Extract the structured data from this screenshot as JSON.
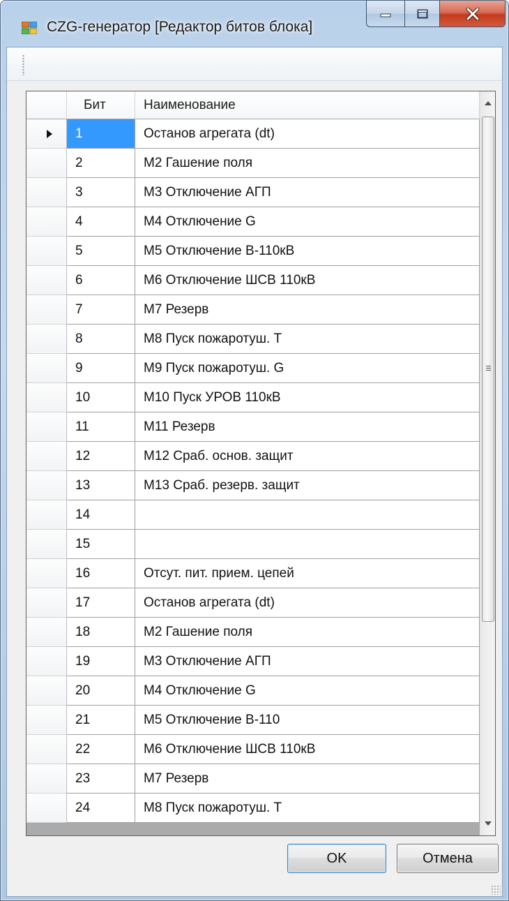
{
  "window": {
    "title": "CZG-генератор [Редактор битов блока]"
  },
  "grid": {
    "columns": [
      "Бит",
      "Наименование"
    ],
    "selected_row": 0,
    "rows": [
      {
        "bit": "1",
        "name": "Останов агрегата (dt)"
      },
      {
        "bit": "2",
        "name": "М2 Гашение поля"
      },
      {
        "bit": "3",
        "name": "М3 Отключение АГП"
      },
      {
        "bit": "4",
        "name": "М4 Отключение G"
      },
      {
        "bit": "5",
        "name": "М5 Отключение В-110кВ"
      },
      {
        "bit": "6",
        "name": "М6 Отключение ШСВ 110кВ"
      },
      {
        "bit": "7",
        "name": "М7 Резерв"
      },
      {
        "bit": "8",
        "name": "М8 Пуск пожаротуш. Т"
      },
      {
        "bit": "9",
        "name": "М9 Пуск пожаротуш. G"
      },
      {
        "bit": "10",
        "name": "М10 Пуск УРОВ 110кВ"
      },
      {
        "bit": "11",
        "name": "М11 Резерв"
      },
      {
        "bit": "12",
        "name": "М12 Сраб. основ. защит"
      },
      {
        "bit": "13",
        "name": "М13 Сраб. резерв. защит"
      },
      {
        "bit": "14",
        "name": ""
      },
      {
        "bit": "15",
        "name": ""
      },
      {
        "bit": "16",
        "name": "Отсут. пит. прием. цепей"
      },
      {
        "bit": "17",
        "name": "Останов агрегата (dt)"
      },
      {
        "bit": "18",
        "name": "М2 Гашение поля"
      },
      {
        "bit": "19",
        "name": "М3 Отключение АГП"
      },
      {
        "bit": "20",
        "name": "М4 Отключение G"
      },
      {
        "bit": "21",
        "name": "М5 Отключение В-110"
      },
      {
        "bit": "22",
        "name": "М6 Отключение ШСВ 110кВ"
      },
      {
        "bit": "23",
        "name": "М7 Резерв"
      },
      {
        "bit": "24",
        "name": "М8 Пуск пожаротуш. Т"
      }
    ]
  },
  "buttons": {
    "ok": "OK",
    "cancel": "Отмена"
  },
  "colors": {
    "selection": "#3399ff",
    "close_button": "#c43a1c"
  },
  "icons": [
    "app-icon",
    "minimize-icon",
    "maximize-icon",
    "close-icon",
    "row-pointer-icon",
    "scroll-up-icon",
    "scroll-down-icon"
  ]
}
